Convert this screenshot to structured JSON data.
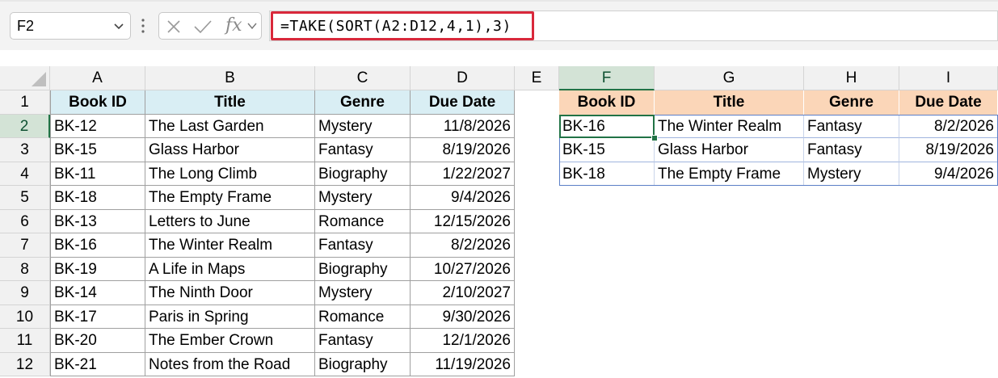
{
  "name_box": {
    "value": "F2"
  },
  "formula_bar": {
    "formula": "=TAKE(SORT(A2:D12,4,1),3)",
    "fx_label": "fx"
  },
  "columns": [
    "A",
    "B",
    "C",
    "D",
    "E",
    "F",
    "G",
    "H",
    "I"
  ],
  "rows": [
    "1",
    "2",
    "3",
    "4",
    "5",
    "6",
    "7",
    "8",
    "9",
    "10",
    "11",
    "12"
  ],
  "source_table": {
    "headers": [
      "Book ID",
      "Title",
      "Genre",
      "Due Date"
    ],
    "rows": [
      [
        "BK-12",
        "The Last Garden",
        "Mystery",
        "11/8/2026"
      ],
      [
        "BK-15",
        "Glass Harbor",
        "Fantasy",
        "8/19/2026"
      ],
      [
        "BK-11",
        "The Long Climb",
        "Biography",
        "1/22/2027"
      ],
      [
        "BK-18",
        "The Empty Frame",
        "Mystery",
        "9/4/2026"
      ],
      [
        "BK-13",
        "Letters to June",
        "Romance",
        "12/15/2026"
      ],
      [
        "BK-16",
        "The Winter Realm",
        "Fantasy",
        "8/2/2026"
      ],
      [
        "BK-19",
        "A Life in Maps",
        "Biography",
        "10/27/2026"
      ],
      [
        "BK-14",
        "The Ninth Door",
        "Mystery",
        "2/10/2027"
      ],
      [
        "BK-17",
        "Paris in Spring",
        "Romance",
        "9/30/2026"
      ],
      [
        "BK-20",
        "The Ember Crown",
        "Fantasy",
        "12/1/2026"
      ],
      [
        "BK-21",
        "Notes from the Road",
        "Biography",
        "11/19/2026"
      ]
    ]
  },
  "result_table": {
    "headers": [
      "Book ID",
      "Title",
      "Genre",
      "Due Date"
    ],
    "rows": [
      [
        "BK-16",
        "The Winter Realm",
        "Fantasy",
        "8/2/2026"
      ],
      [
        "BK-15",
        "Glass Harbor",
        "Fantasy",
        "8/19/2026"
      ],
      [
        "BK-18",
        "The Empty Frame",
        "Mystery",
        "9/4/2026"
      ]
    ]
  },
  "colors": {
    "source_header": "#d9eef4",
    "result_header": "#fbd6b8",
    "formula_highlight": "#d9283b",
    "active_cell": "#217346"
  },
  "selected_cell": "F2"
}
